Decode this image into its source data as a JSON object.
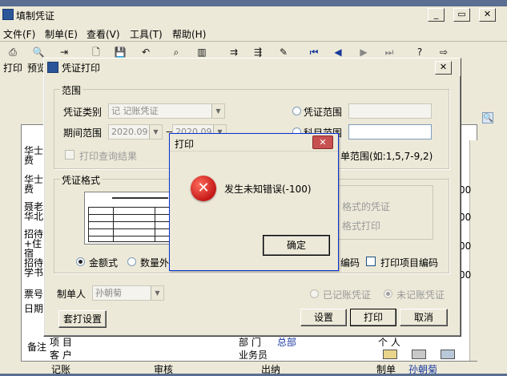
{
  "main_window": {
    "title": "填制凭证",
    "menu": [
      "文件(F)",
      "制单(E)",
      "查看(V)",
      "工具(T)",
      "帮助(H)"
    ],
    "toolbar_labels": [
      "打印",
      "预览"
    ],
    "bg_rows": [
      "华士费",
      "华士费",
      "聂老华北",
      "招待+住宿",
      "招待学书",
      "票号",
      "日期"
    ],
    "bg_right_vals": [
      "00",
      "00",
      "00",
      "00"
    ],
    "footer": {
      "item_label": "项 目",
      "customer_label": "客 户",
      "dept_label": "部 门",
      "dept_value": "总部",
      "staff_label": "业务员",
      "person_label": "个 人",
      "note_label": "备注",
      "sign_labels": [
        "记账",
        "审核",
        "出纳",
        "制单"
      ],
      "preparer": "孙朝菊"
    }
  },
  "print_dialog": {
    "title": "凭证打印",
    "range_group": "范围",
    "voucher_type_label": "凭证类别",
    "voucher_type_value": "记    记账凭证",
    "period_label": "期间范围",
    "period_from": "2020.09",
    "period_to": "2020.09",
    "voucher_range_label": "凭证范围",
    "voucher_range_value": "",
    "other_range_label": "科目范围",
    "print_query_label": "打印查询结果",
    "range_hint": "单范围(如:1,5,7-9,2)",
    "format_group": "凭证格式",
    "format_amount": "金额式",
    "format_qty": "数量外币式",
    "right_opt1": "格式的凭证",
    "right_opt2": "格式打印",
    "code_label": "编码",
    "print_item_code": "打印项目编码",
    "maker_label": "制单人",
    "maker_value": "孙朝菊",
    "posted": "已记账凭证",
    "unposted": "未记账凭证",
    "btn_template": "套打设置",
    "btn_settings": "设置",
    "btn_print": "打印",
    "btn_cancel": "取消"
  },
  "error_dialog": {
    "title": "打印",
    "message": "发生未知错误(-100)",
    "ok": "确定"
  }
}
